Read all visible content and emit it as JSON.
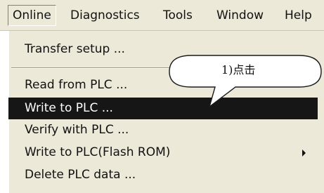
{
  "menubar": {
    "items": [
      {
        "label": "Online"
      },
      {
        "label": "Diagnostics"
      },
      {
        "label": "Tools"
      },
      {
        "label": "Window"
      },
      {
        "label": "Help"
      }
    ],
    "open_item": "Online"
  },
  "dropdown": {
    "items": [
      {
        "label": "Transfer setup ..."
      },
      {
        "label": "Read from PLC ..."
      },
      {
        "label": "Write to PLC ...",
        "highlighted": true
      },
      {
        "label": "Verify with PLC ..."
      },
      {
        "label": "Write to PLC(Flash ROM)",
        "has_submenu": true
      },
      {
        "label": "Delete PLC data ..."
      }
    ]
  },
  "callout": {
    "text": "1)点击"
  },
  "colors": {
    "menu_bg": "#ece9d8",
    "highlight_bg": "#161616",
    "highlight_text": "#ffffff",
    "text": "#111111"
  }
}
